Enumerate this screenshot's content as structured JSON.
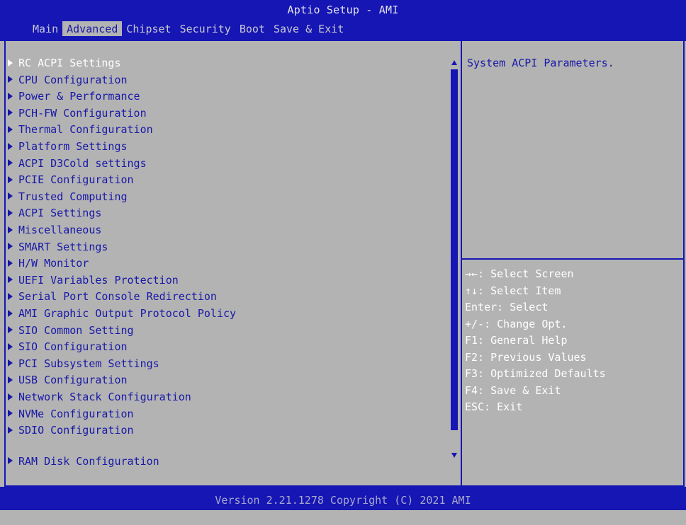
{
  "header": {
    "title": "Aptio Setup - AMI",
    "tabs": [
      {
        "label": "Main",
        "selected": false
      },
      {
        "label": "Advanced",
        "selected": true
      },
      {
        "label": "Chipset",
        "selected": false
      },
      {
        "label": "Security",
        "selected": false
      },
      {
        "label": "Boot",
        "selected": false
      },
      {
        "label": "Save & Exit",
        "selected": false
      }
    ]
  },
  "menu": {
    "items": [
      {
        "label": "RC ACPI Settings",
        "highlighted": true
      },
      {
        "label": "CPU Configuration"
      },
      {
        "label": "Power & Performance"
      },
      {
        "label": "PCH-FW Configuration"
      },
      {
        "label": "Thermal Configuration"
      },
      {
        "label": "Platform Settings"
      },
      {
        "label": "ACPI D3Cold settings"
      },
      {
        "label": "PCIE Configuration"
      },
      {
        "label": "Trusted Computing"
      },
      {
        "label": "ACPI Settings"
      },
      {
        "label": "Miscellaneous"
      },
      {
        "label": "SMART Settings"
      },
      {
        "label": "H/W Monitor"
      },
      {
        "label": "UEFI Variables Protection"
      },
      {
        "label": "Serial Port Console Redirection"
      },
      {
        "label": "AMI Graphic Output Protocol Policy"
      },
      {
        "label": "SIO Common Setting"
      },
      {
        "label": "SIO Configuration"
      },
      {
        "label": "PCI Subsystem Settings"
      },
      {
        "label": "USB Configuration"
      },
      {
        "label": "Network Stack Configuration"
      },
      {
        "label": "NVMe Configuration"
      },
      {
        "label": "SDIO Configuration"
      },
      {
        "label": "RAM Disk Configuration"
      }
    ]
  },
  "help": {
    "description": "System ACPI Parameters.",
    "keys": [
      "→←: Select Screen",
      "↑↓: Select Item",
      "Enter: Select",
      "+/-: Change Opt.",
      "F1: General Help",
      "F2: Previous Values",
      "F3: Optimized Defaults",
      "F4: Save & Exit",
      "ESC: Exit"
    ]
  },
  "footer": {
    "text": "Version 2.21.1278 Copyright (C) 2021 AMI"
  },
  "colors": {
    "background": "#b3b3b3",
    "bar_blue": "#1616b4",
    "text_blue": "#1818a8",
    "highlight_text": "#ffffff"
  },
  "icons": {
    "submenu": "triangle-right-icon",
    "scroll_up": "triangle-up-icon",
    "scroll_down": "triangle-down-icon"
  }
}
